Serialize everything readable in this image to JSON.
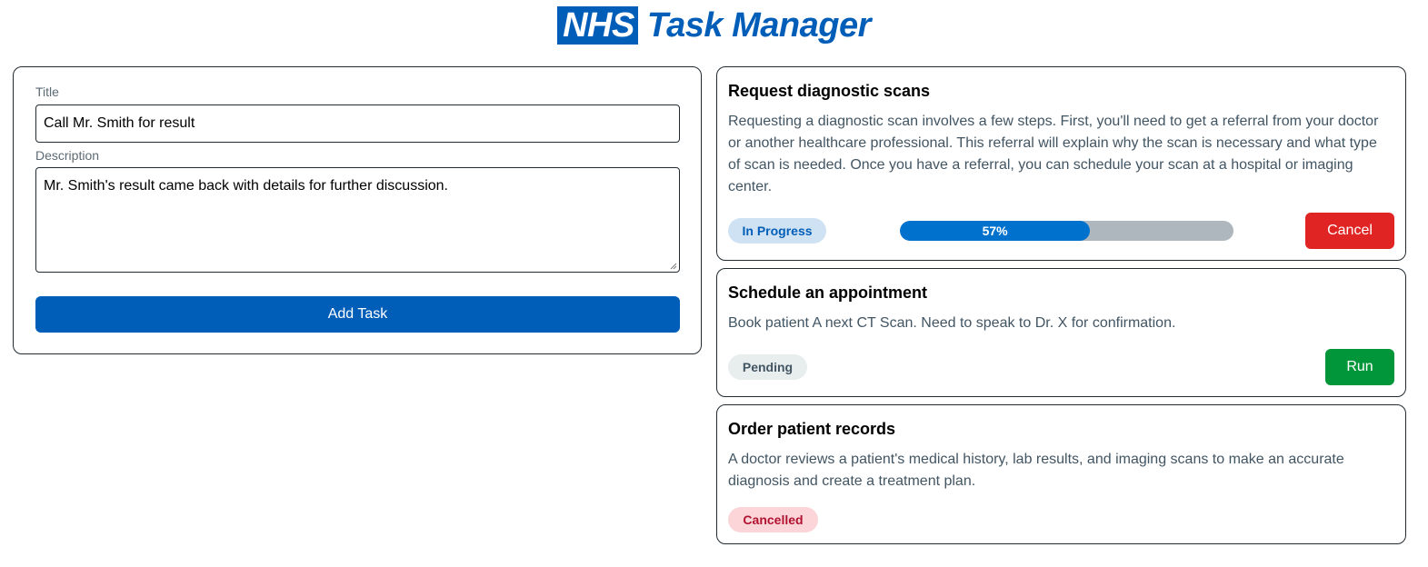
{
  "header": {
    "logo": "NHS",
    "title": "Task Manager"
  },
  "form": {
    "title_label": "Title",
    "title_value": "Call Mr. Smith for result",
    "description_label": "Description",
    "description_value": "Mr. Smith's result came back with details for further discussion.",
    "submit_label": "Add Task"
  },
  "tasks": [
    {
      "title": "Request diagnostic scans",
      "description": "Requesting a diagnostic scan involves a few steps. First, you'll need to get a referral from your doctor or another healthcare professional. This referral will explain why the scan is necessary and what type of scan is needed. Once you have a referral, you can schedule your scan at a hospital or imaging center.",
      "status": "In Progress",
      "progress": 57,
      "progress_label": "57%",
      "action_label": "Cancel"
    },
    {
      "title": "Schedule an appointment",
      "description": "Book patient A next CT Scan. Need to speak to Dr. X for confirmation.",
      "status": "Pending",
      "action_label": "Run"
    },
    {
      "title": "Order patient records",
      "description": "A doctor reviews a patient's medical history, lab results, and imaging scans to make an accurate diagnosis and create a treatment plan.",
      "status": "Cancelled"
    }
  ],
  "colors": {
    "brand": "#005eb8",
    "progress_fill": "#0072ce",
    "cancel": "#e02424",
    "run": "#009639"
  }
}
